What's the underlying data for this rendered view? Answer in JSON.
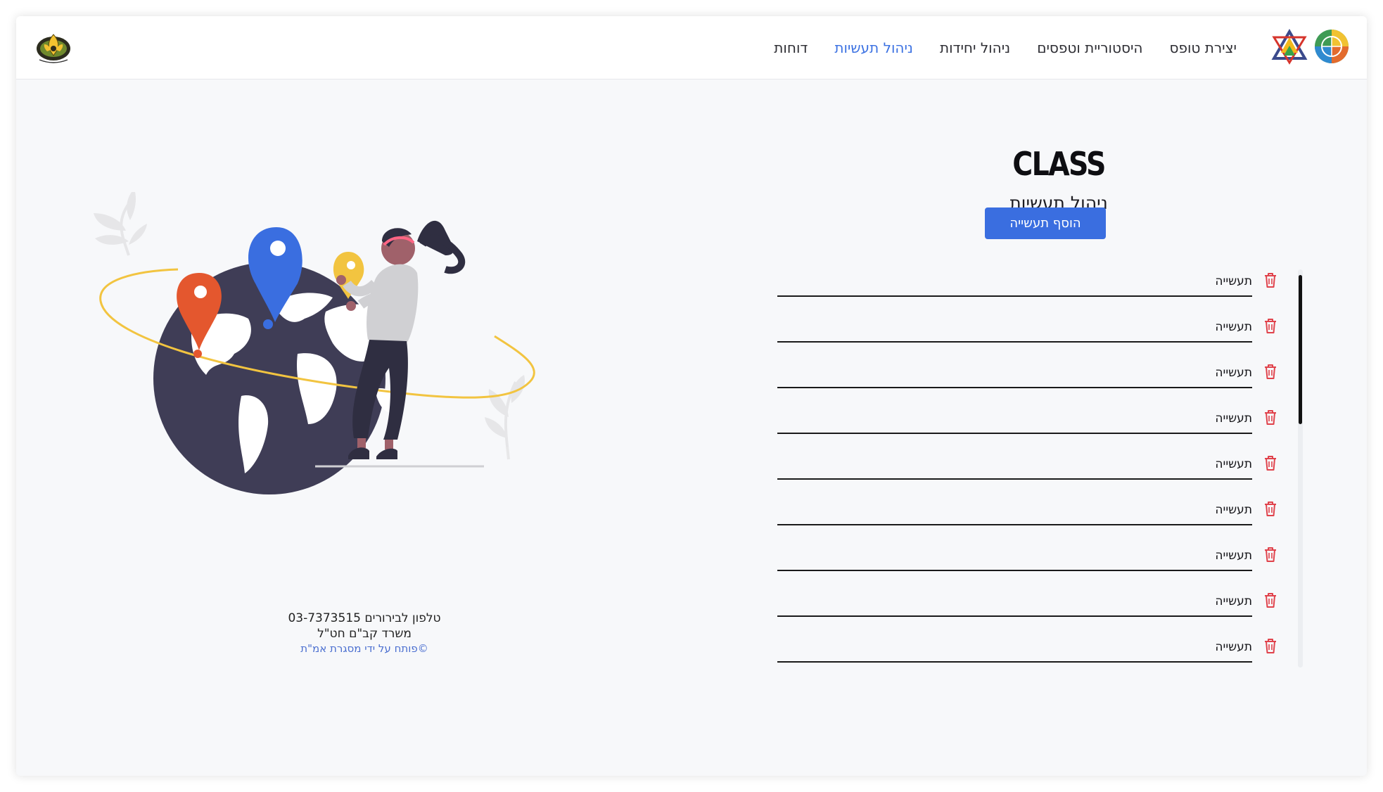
{
  "navbar": {
    "links": [
      {
        "label": "יצירת טופס",
        "active": false
      },
      {
        "label": "היסטוריית וטפסים",
        "active": false
      },
      {
        "label": "ניהול יחידות",
        "active": false
      },
      {
        "label": "ניהול תעשיות",
        "active": true
      },
      {
        "label": "דוחות",
        "active": false
      }
    ],
    "logo_left_icon": "scout-emblem-logo",
    "logo_right_icons": [
      "globe-logo",
      "star-of-david-triangle-logo"
    ]
  },
  "main": {
    "brand": "CLASS",
    "title": "ניהול תעשיות",
    "add_button": "הוסף תעשייה",
    "items": [
      {
        "label": "תעשייה"
      },
      {
        "label": "תעשייה"
      },
      {
        "label": "תעשייה"
      },
      {
        "label": "תעשייה"
      },
      {
        "label": "תעשייה"
      },
      {
        "label": "תעשייה"
      },
      {
        "label": "תעשייה"
      },
      {
        "label": "תעשייה"
      },
      {
        "label": "תעשייה"
      }
    ],
    "item_icon": "trash-icon"
  },
  "footer": {
    "phone": "טלפון לבירורים 03-7373515",
    "office": "משרד קב\"ם חט\"ל",
    "credit": "פותח על ידי מסגרת אמ\"ת©"
  },
  "colors": {
    "accent": "#3a6ee0",
    "active_link": "#3b71e2",
    "trash": "#e0424b",
    "globe": "#3f3d56",
    "pin_orange": "#e4572e",
    "pin_blue": "#3a6ee0",
    "pin_yellow": "#f2c440"
  }
}
